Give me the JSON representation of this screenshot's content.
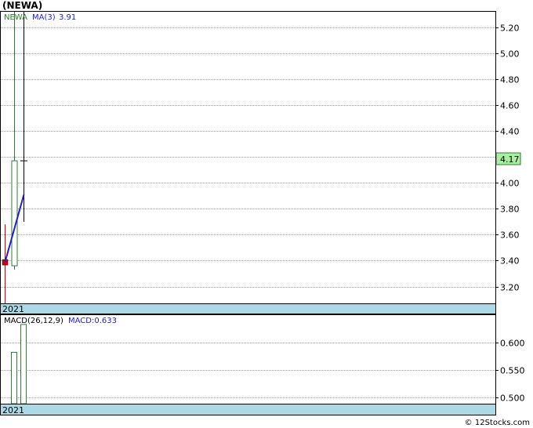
{
  "header": {
    "title": "(NEWA)"
  },
  "footer": {
    "credit": "© 12Stocks.com"
  },
  "chart_data": [
    {
      "type": "candlestick",
      "legend": {
        "ticker": "NEWA",
        "ma_label": "MA(3)",
        "ma_value": "3.91"
      },
      "year_label": "2021",
      "ylim": [
        3.07,
        5.32
      ],
      "yticks": [
        3.2,
        3.4,
        3.6,
        3.8,
        4.0,
        4.2,
        4.4,
        4.6,
        4.8,
        5.0,
        5.2
      ],
      "ytick_labels": [
        "3.20",
        "3.40",
        "3.60",
        "3.80",
        "4.00",
        "4.20",
        "4.40",
        "4.60",
        "4.80",
        "5.00",
        "5.20"
      ],
      "grid": true,
      "last_price": {
        "value": 4.17,
        "label": "4.17"
      },
      "candles": [
        {
          "open": 3.39,
          "high": 3.68,
          "low": 3.07,
          "close": 3.39,
          "color": "#cc0000"
        },
        {
          "open": 3.36,
          "high": 5.32,
          "low": 3.33,
          "close": 4.17,
          "color": "#2e7d32"
        },
        {
          "open": 4.17,
          "high": 5.32,
          "low": 3.7,
          "close": 4.17,
          "color": "#000000"
        }
      ],
      "ma_line": {
        "values": [
          3.39,
          3.65,
          3.91
        ],
        "color": "#1f1fcc"
      }
    },
    {
      "type": "bar",
      "legend": {
        "label": "MACD(26,12,9)",
        "value_label": "MACD:0.633"
      },
      "year_label": "2021",
      "ylim": [
        0.488,
        0.65
      ],
      "yticks": [
        0.5,
        0.55,
        0.6
      ],
      "ytick_labels": [
        "0.500",
        "0.550",
        "0.600"
      ],
      "grid": true,
      "values": [
        0.0,
        0.582,
        0.633
      ],
      "color": "#2e7d32"
    }
  ]
}
